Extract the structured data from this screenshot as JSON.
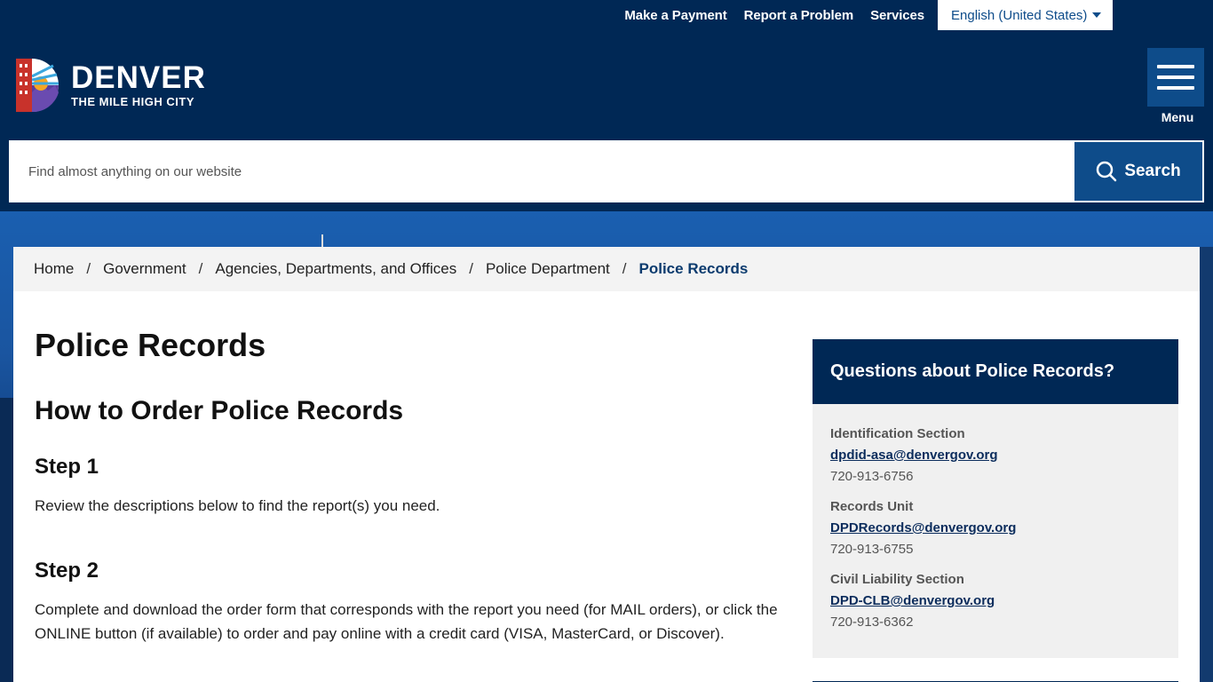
{
  "utility": {
    "links": [
      "Make a Payment",
      "Report a Problem",
      "Services"
    ],
    "language": "English (United States)"
  },
  "logo": {
    "title": "DENVER",
    "subtitle": "THE MILE HIGH CITY"
  },
  "menu": {
    "label": "Menu"
  },
  "search": {
    "placeholder": "Find almost anything on our website",
    "button": "Search"
  },
  "breadcrumb": {
    "items": [
      "Home",
      "Government",
      "Agencies, Departments, and Offices",
      "Police Department"
    ],
    "current": "Police Records"
  },
  "page": {
    "title": "Police Records",
    "heading": "How to Order Police Records",
    "step1_title": "Step 1",
    "step1_text": "Review the descriptions below to find the report(s) you need.",
    "step2_title": "Step 2",
    "step2_text": "Complete and download the order form that corresponds with the report you need (for MAIL orders), or click the ONLINE button (if available) to order and pay online with a credit card (VISA, MasterCard, or Discover)."
  },
  "sidebar": {
    "title": "Questions about Police Records?",
    "contacts": [
      {
        "label": "Identification Section",
        "email": "dpdid-asa@denvergov.org",
        "phone": "720-913-6756"
      },
      {
        "label": "Records Unit",
        "email": "DPDRecords@denvergov.org",
        "phone": "720-913-6755"
      },
      {
        "label": "Civil Liability Section",
        "email": "DPD-CLB@denvergov.org",
        "phone": "720-913-6362"
      }
    ]
  },
  "colors": {
    "navy": "#002855",
    "accent_blue": "#0e4c8a"
  },
  "icons": {
    "search": "search-icon",
    "menu": "hamburger-icon",
    "dropdown": "caret-down-icon"
  }
}
